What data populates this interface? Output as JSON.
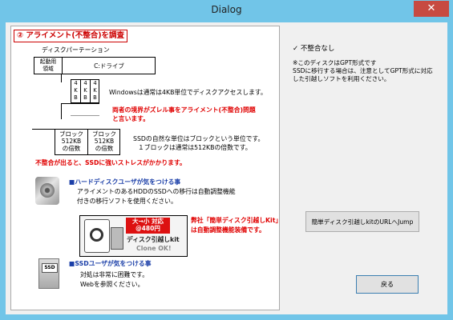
{
  "window": {
    "title": "Dialog",
    "close_glyph": "✕"
  },
  "panel": {
    "heading": "② アライメント(不整合)を調査",
    "disk_partition_label": "ディスクパーテーション",
    "boot_area_label": "起動用\n領域",
    "c_drive_label": "C:ドライブ",
    "kb_cell": "4\nK\nB",
    "windows_note": "Windowsは通常は4KB単位でディスクアクセスします。",
    "mismatch_note_line1": "両者の境界がズレル事をアライメント(不整合)問題",
    "mismatch_note_line2": "と言います。",
    "block_cell": "ブロック\n512KB\nの倍数",
    "ssd_note_line1": "SSDの自然な単位はブロックという単位です。",
    "ssd_note_line2": "１ブロックは通常は512KBの倍数です。",
    "stress_note": "不整合が出ると、SSDに強いストレスがかかります。",
    "hdd_user_heading": "■ハードディスクユーザが気をつける事",
    "hdd_user_line1": "アライメントのあるHDDのSSDへの移行は自動調整機能",
    "hdd_user_line2": "付きの移行ソフトを使用ください。",
    "product_badge_line1": "大→小 対応",
    "product_badge_line2": "@480円",
    "product_name": "ディスク引越しkit",
    "product_tagline": "Clone OK!",
    "product_note_line1": "弊社「簡単ディスク引越しKit」",
    "product_note_line2": "は自動調整機能装備です。",
    "ssd_user_heading": "■SSDユーザが気をつける事",
    "ssd_user_line1": "対処は非常に困難です。",
    "ssd_user_line2": "Webを参照ください。",
    "ssd_icon_label": "SSD"
  },
  "status": {
    "check_mark": "✓",
    "result": "不整合なし",
    "note_line1": "※このディスクはGPT形式です",
    "note_line2": "SSDに移行する場合は、注意としてGPT形式に対応",
    "note_line3": "した引越しソフトを利用ください。"
  },
  "buttons": {
    "jump": "簡単ディスク引越しkitのURLへJump",
    "back": "戻る"
  }
}
